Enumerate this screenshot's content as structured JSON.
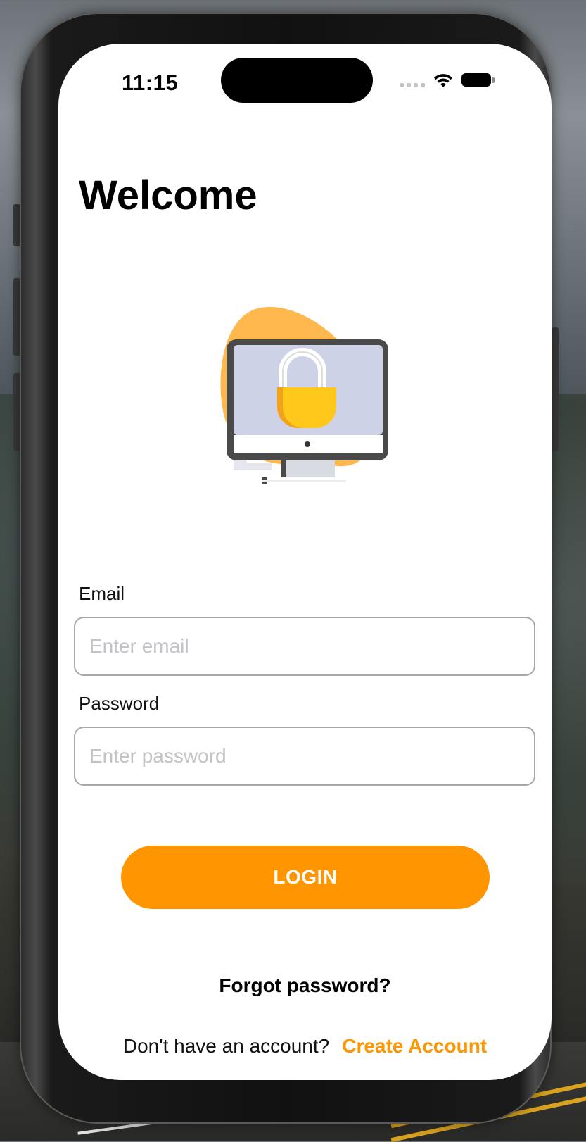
{
  "status_bar": {
    "time": "11:15",
    "wifi_icon": "wifi-icon",
    "battery_icon": "battery-icon"
  },
  "screen": {
    "title": "Welcome",
    "illustration": "computer-lock-icon"
  },
  "form": {
    "email": {
      "label": "Email",
      "placeholder": "Enter email",
      "value": ""
    },
    "password": {
      "label": "Password",
      "placeholder": "Enter password",
      "value": ""
    }
  },
  "actions": {
    "login_label": "LOGIN",
    "forgot_password": "Forgot password?",
    "signup_prompt": "Don't have an account?",
    "create_account": "Create Account"
  },
  "colors": {
    "accent": "#ff9500",
    "text": "#000000",
    "placeholder": "#c3c3c8",
    "input_border": "#a8a8a8"
  }
}
